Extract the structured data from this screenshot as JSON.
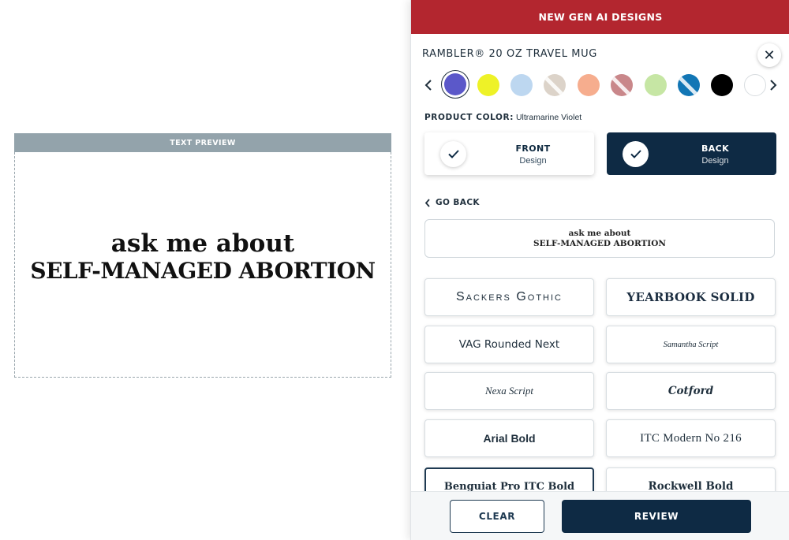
{
  "preview": {
    "header": "TEXT PREVIEW",
    "line1": "ask me about",
    "line2": "SELF-MANAGED ABORTION"
  },
  "panel": {
    "banner": "NEW GEN AI DESIGNS",
    "product_title": "RAMBLER® 20 OZ TRAVEL MUG",
    "close_icon": "close-icon",
    "color_label_key": "PRODUCT COLOR:",
    "color_label_value": "Ultramarine Violet",
    "swatches": [
      {
        "color": "#5b58c9",
        "slash": false,
        "selected": true
      },
      {
        "color": "#eef227",
        "slash": false,
        "selected": false
      },
      {
        "color": "#bdd7f0",
        "slash": false,
        "selected": false
      },
      {
        "color": "#dcd3c9",
        "slash": true,
        "selected": false
      },
      {
        "color": "#f6ad8e",
        "slash": false,
        "selected": false
      },
      {
        "color": "#c9878a",
        "slash": true,
        "selected": false
      },
      {
        "color": "#c6e6a4",
        "slash": false,
        "selected": false
      },
      {
        "color": "#1276b5",
        "slash": true,
        "selected": false
      },
      {
        "color": "#000000",
        "slash": false,
        "selected": false
      },
      {
        "color": "#ffffff",
        "slash": false,
        "selected": false
      }
    ],
    "front": {
      "title": "FRONT",
      "sub": "Design"
    },
    "back": {
      "title": "BACK",
      "sub": "Design"
    },
    "go_back": "GO BACK",
    "text_input": {
      "line1": "ask me about",
      "line2": "SELF-MANAGED ABORTION"
    },
    "fonts": [
      "Sackers Gothic",
      "YEARBOOK SOLID",
      "VAG Rounded Next",
      "Samantha Script",
      "Nexa Script",
      "Cotford",
      "Arial Bold",
      "ITC Modern No 216",
      "Benguiat Pro ITC Bold",
      "Rockwell Bold"
    ],
    "clear_label": "CLEAR",
    "review_label": "REVIEW"
  },
  "colors": {
    "banner": "#b3262f",
    "navy": "#0e2a44",
    "preview_header": "#93a3ab"
  }
}
